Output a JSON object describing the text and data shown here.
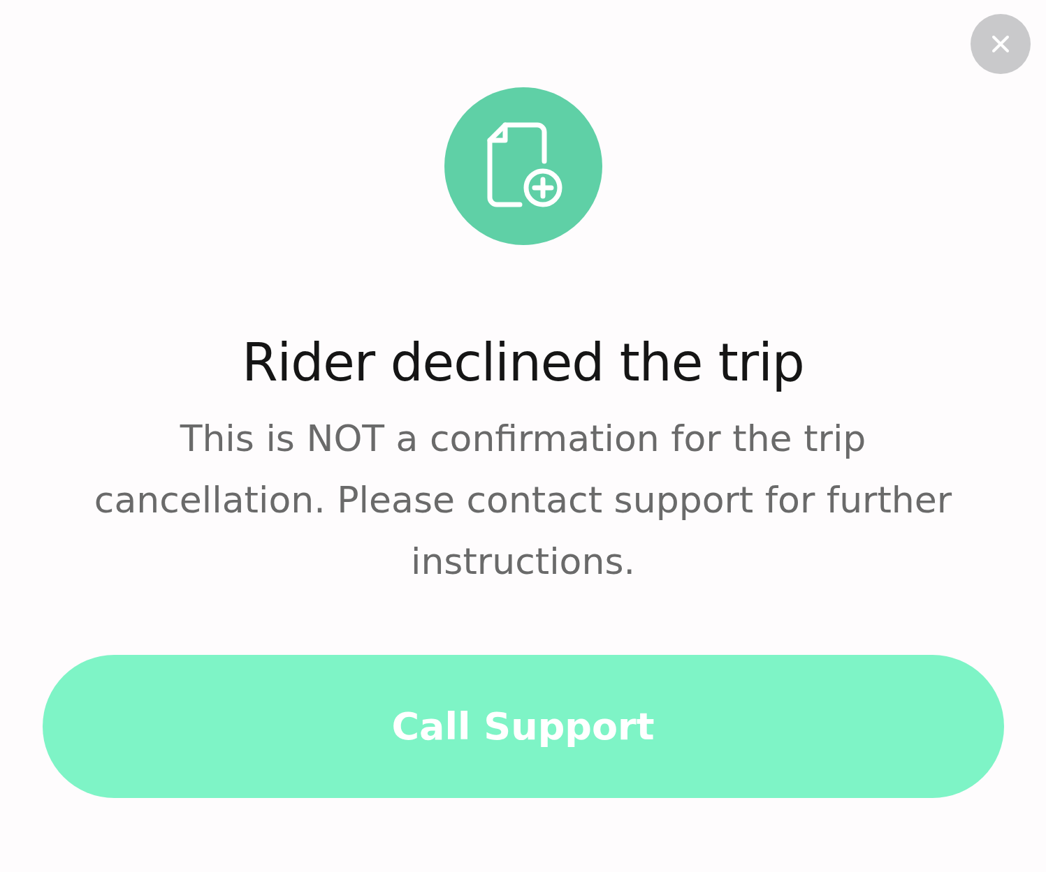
{
  "dialog": {
    "title": "Rider declined the trip",
    "message": "This is NOT a confirmation for the trip cancellation. Please contact support for further instructions.",
    "button": "Call Support"
  }
}
